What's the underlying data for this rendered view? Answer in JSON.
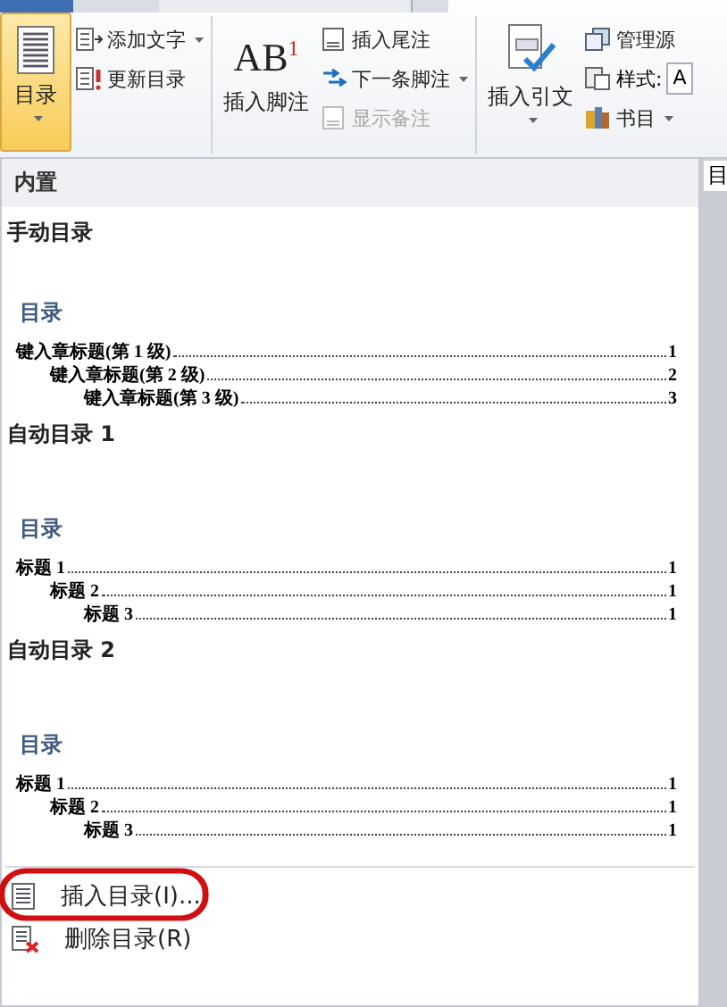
{
  "ribbon": {
    "toc_button": {
      "label": "目录",
      "selected": true
    },
    "toc_small_buttons": [
      {
        "label": "添加文字",
        "dropdown": true
      },
      {
        "label": "更新目录",
        "dropdown": false
      }
    ],
    "footnote_button": {
      "label": "插入脚注",
      "icon_text": "AB$^{1}$"
    },
    "footnote_small_buttons": [
      {
        "label": "插入尾注",
        "dropdown": false,
        "disabled": false
      },
      {
        "label": "下一条脚注",
        "dropdown": true,
        "disabled": false
      },
      {
        "label": "显示备注",
        "dropdown": false,
        "disabled": true
      }
    ],
    "citation_button": {
      "label": "插入引文",
      "dropdown": true
    },
    "citation_small_buttons": [
      {
        "kind": "button",
        "label": "管理源"
      },
      {
        "kind": "select",
        "label": "样式:",
        "value": "A"
      },
      {
        "kind": "dropdown",
        "label": "书目"
      }
    ],
    "group_label_fragment": "目"
  },
  "gallery": {
    "header": "内置",
    "sections": [
      {
        "title": "手动目录",
        "toc_title": "目录",
        "entries": [
          {
            "text": "键入章标题(第 1 级)",
            "page": "1",
            "children": [
              {
                "text": "键入章标题(第 2 级)",
                "page": "2",
                "children": [
                  {
                    "text": "键入章标题(第 3 级)",
                    "page": "3"
                  }
                ]
              }
            ]
          }
        ]
      },
      {
        "title": "自动目录 1",
        "toc_title": "目录",
        "entries": [
          {
            "text": "标题 1",
            "page": "1",
            "children": [
              {
                "text": "标题 2",
                "page": "1",
                "children": [
                  {
                    "text": "标题 3",
                    "page": "1"
                  }
                ]
              }
            ]
          }
        ]
      },
      {
        "title": "自动目录 2",
        "toc_title": "目录",
        "entries": [
          {
            "text": "标题 1",
            "page": "1",
            "children": [
              {
                "text": "标题 2",
                "page": "1",
                "children": [
                  {
                    "text": "标题 3",
                    "page": "1"
                  }
                ]
              }
            ]
          }
        ]
      }
    ]
  },
  "menu": [
    {
      "kind": "insert",
      "label": "插入目录(I)...",
      "annotated": true
    },
    {
      "kind": "delete",
      "label": "删除目录(R)",
      "annotated": false
    }
  ]
}
